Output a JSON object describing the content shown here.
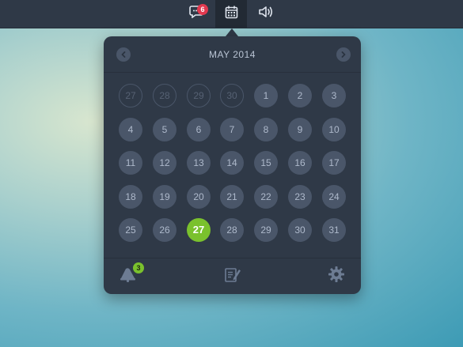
{
  "topbar": {
    "messages_badge": "6"
  },
  "calendar": {
    "month_title": "MAY 2014",
    "weeks": [
      [
        {
          "d": "27",
          "muted": true
        },
        {
          "d": "28",
          "muted": true
        },
        {
          "d": "29",
          "muted": true
        },
        {
          "d": "30",
          "muted": true
        },
        {
          "d": "1"
        },
        {
          "d": "2"
        },
        {
          "d": "3"
        }
      ],
      [
        {
          "d": "4"
        },
        {
          "d": "5"
        },
        {
          "d": "6"
        },
        {
          "d": "7"
        },
        {
          "d": "8"
        },
        {
          "d": "9"
        },
        {
          "d": "10"
        }
      ],
      [
        {
          "d": "11"
        },
        {
          "d": "12"
        },
        {
          "d": "13"
        },
        {
          "d": "14"
        },
        {
          "d": "15"
        },
        {
          "d": "16"
        },
        {
          "d": "17"
        }
      ],
      [
        {
          "d": "18"
        },
        {
          "d": "19"
        },
        {
          "d": "20"
        },
        {
          "d": "21"
        },
        {
          "d": "22"
        },
        {
          "d": "23"
        },
        {
          "d": "24"
        }
      ],
      [
        {
          "d": "25"
        },
        {
          "d": "26"
        },
        {
          "d": "27",
          "today": true
        },
        {
          "d": "28"
        },
        {
          "d": "29"
        },
        {
          "d": "30"
        },
        {
          "d": "31"
        }
      ]
    ]
  },
  "footer": {
    "notifications_badge": "3"
  },
  "colors": {
    "accent": "#7ac12d",
    "badge_red": "#e2384f",
    "panel": "#2f3947",
    "day_bg": "#4a5669"
  },
  "icons": {
    "messages": "chat-bubble-icon",
    "calendar": "calendar-icon",
    "sound": "speaker-icon",
    "prev": "chevron-left-icon",
    "next": "chevron-right-icon",
    "notifications": "bell-icon",
    "notes": "note-edit-icon",
    "settings": "gear-icon"
  }
}
